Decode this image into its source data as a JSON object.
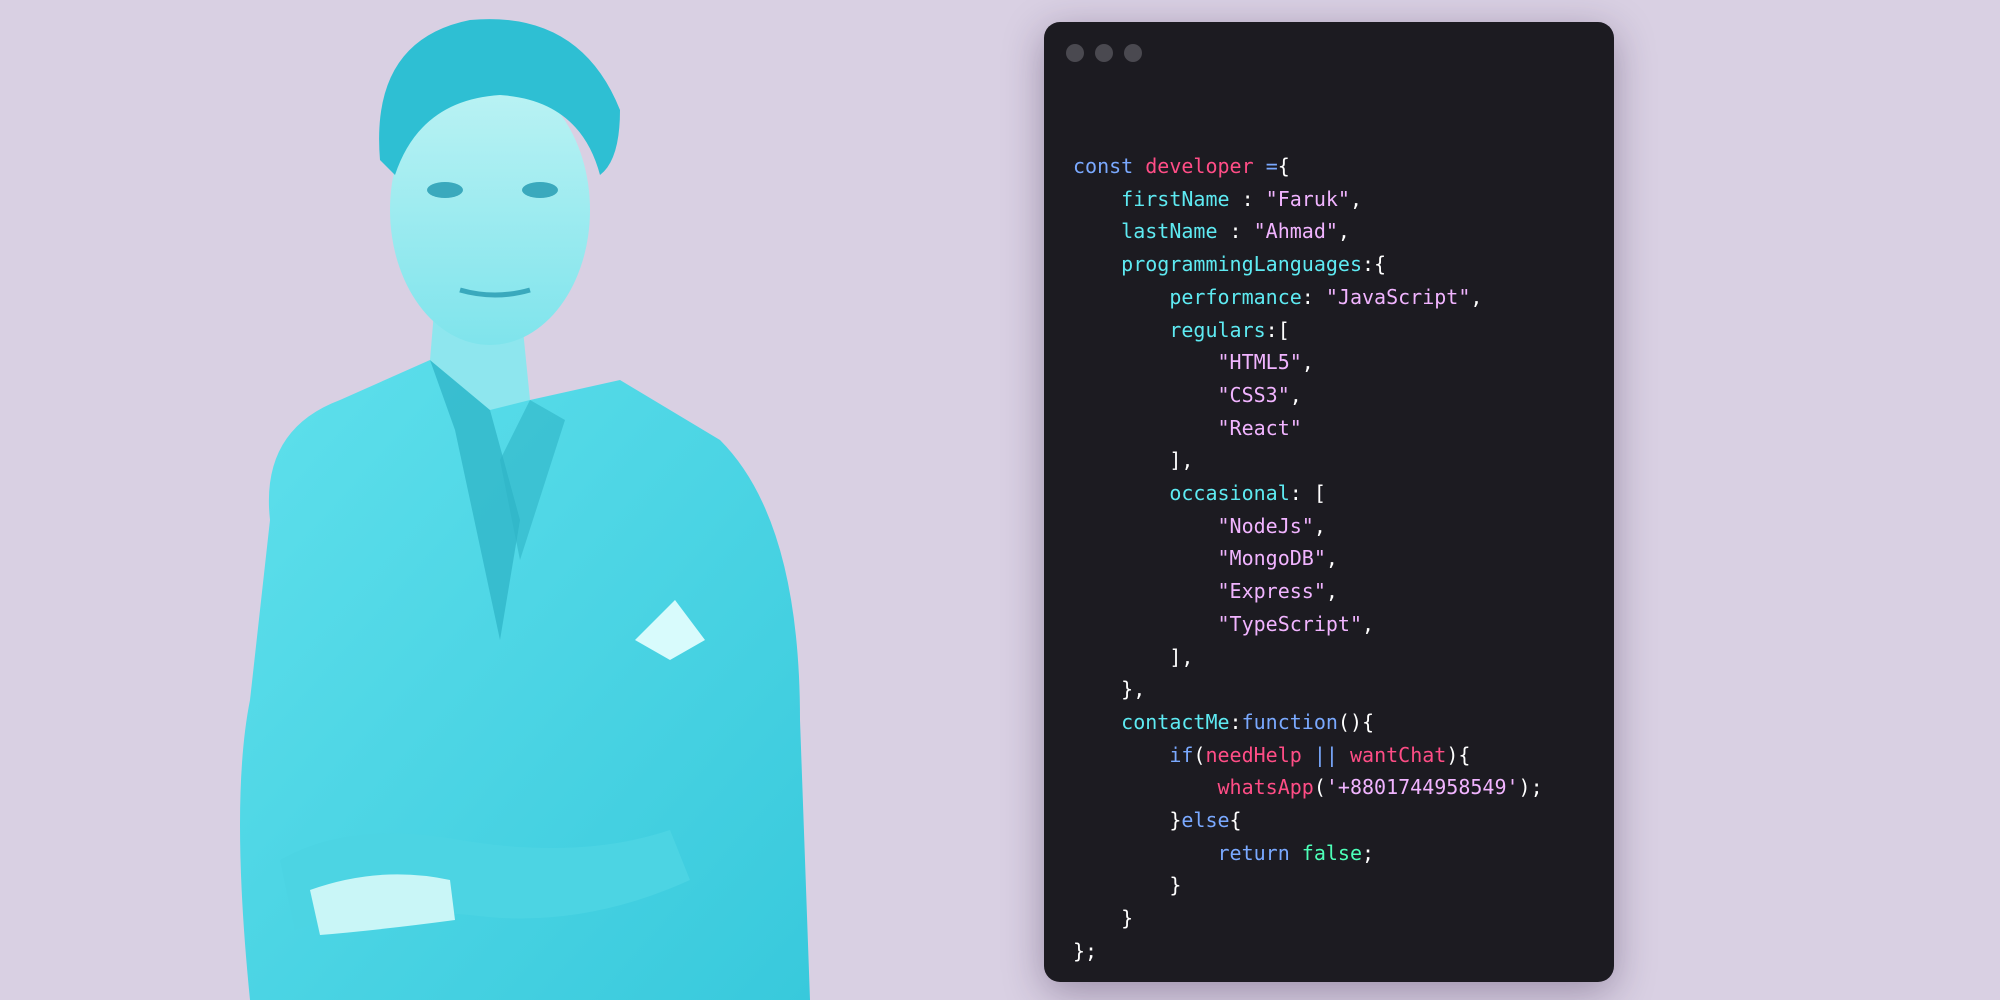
{
  "colors": {
    "background": "#d9d0e3",
    "window": "#1c1b21",
    "keyword": "#7aa9ff",
    "variable": "#ff4d86",
    "property": "#5eeaf2",
    "string": "#f1b4ff",
    "boolean": "#4dffb8",
    "portrait_tint": "#4fd9e6"
  },
  "window_controls": [
    "close-dot",
    "minimize-dot",
    "maximize-dot"
  ],
  "code": {
    "kw_const": "const",
    "var_developer": "developer",
    "op_assign": "=",
    "prop_firstName": "firstName",
    "str_firstName": "\"Faruk\"",
    "prop_lastName": "lastName",
    "str_lastName": "\"Ahmad\"",
    "prop_programmingLanguages": "programmingLanguages",
    "prop_performance": "performance",
    "str_performance": "\"JavaScript\"",
    "prop_regulars": "regulars",
    "regulars": [
      "\"HTML5\"",
      "\"CSS3\"",
      "\"React\""
    ],
    "prop_occasional": "occasional",
    "occasional": [
      "\"NodeJs\"",
      "\"MongoDB\"",
      "\"Express\"",
      "\"TypeScript\""
    ],
    "prop_contactMe": "contactMe",
    "kw_function": "function",
    "kw_if": "if",
    "var_needHelp": "needHelp",
    "op_or": "||",
    "var_wantChat": "wantChat",
    "fn_whatsApp": "whatsApp",
    "str_phone": "'+8801744958549'",
    "kw_else": "else",
    "kw_return": "return",
    "bool_false": "false"
  }
}
